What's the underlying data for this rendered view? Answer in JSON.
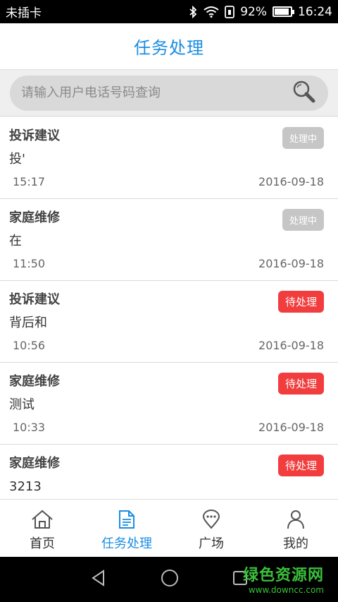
{
  "statusbar": {
    "carrier": "未插卡",
    "battery_percent": "92%",
    "battery_level": 0.92,
    "time": "16:24"
  },
  "header": {
    "title": "任务处理"
  },
  "search": {
    "placeholder": "请输入用户电话号码查询"
  },
  "tasks": [
    {
      "category": "投诉建议",
      "content": "投'",
      "time": "15:17",
      "date": "2016-09-18",
      "status": "处理中",
      "status_type": "processing"
    },
    {
      "category": "家庭维修",
      "content": "在",
      "time": "11:50",
      "date": "2016-09-18",
      "status": "处理中",
      "status_type": "processing"
    },
    {
      "category": "投诉建议",
      "content": "背后和",
      "time": "10:56",
      "date": "2016-09-18",
      "status": "待处理",
      "status_type": "pending"
    },
    {
      "category": "家庭维修",
      "content": "测试",
      "time": "10:33",
      "date": "2016-09-18",
      "status": "待处理",
      "status_type": "pending"
    },
    {
      "category": "家庭维修",
      "content": "3213",
      "time": "",
      "date": "",
      "status": "待处理",
      "status_type": "pending"
    }
  ],
  "tabbar": {
    "tabs": [
      {
        "label": "首页",
        "icon": "home-icon",
        "active": false
      },
      {
        "label": "任务处理",
        "icon": "document-icon",
        "active": true
      },
      {
        "label": "广场",
        "icon": "location-chat-icon",
        "active": false
      },
      {
        "label": "我的",
        "icon": "person-icon",
        "active": false
      }
    ]
  },
  "watermark": {
    "name": "绿色资源网",
    "url": "www.downcc.com"
  },
  "colors": {
    "accent": "#1a8de0",
    "pending": "#f13d3d",
    "processing": "#c6c6c6"
  }
}
